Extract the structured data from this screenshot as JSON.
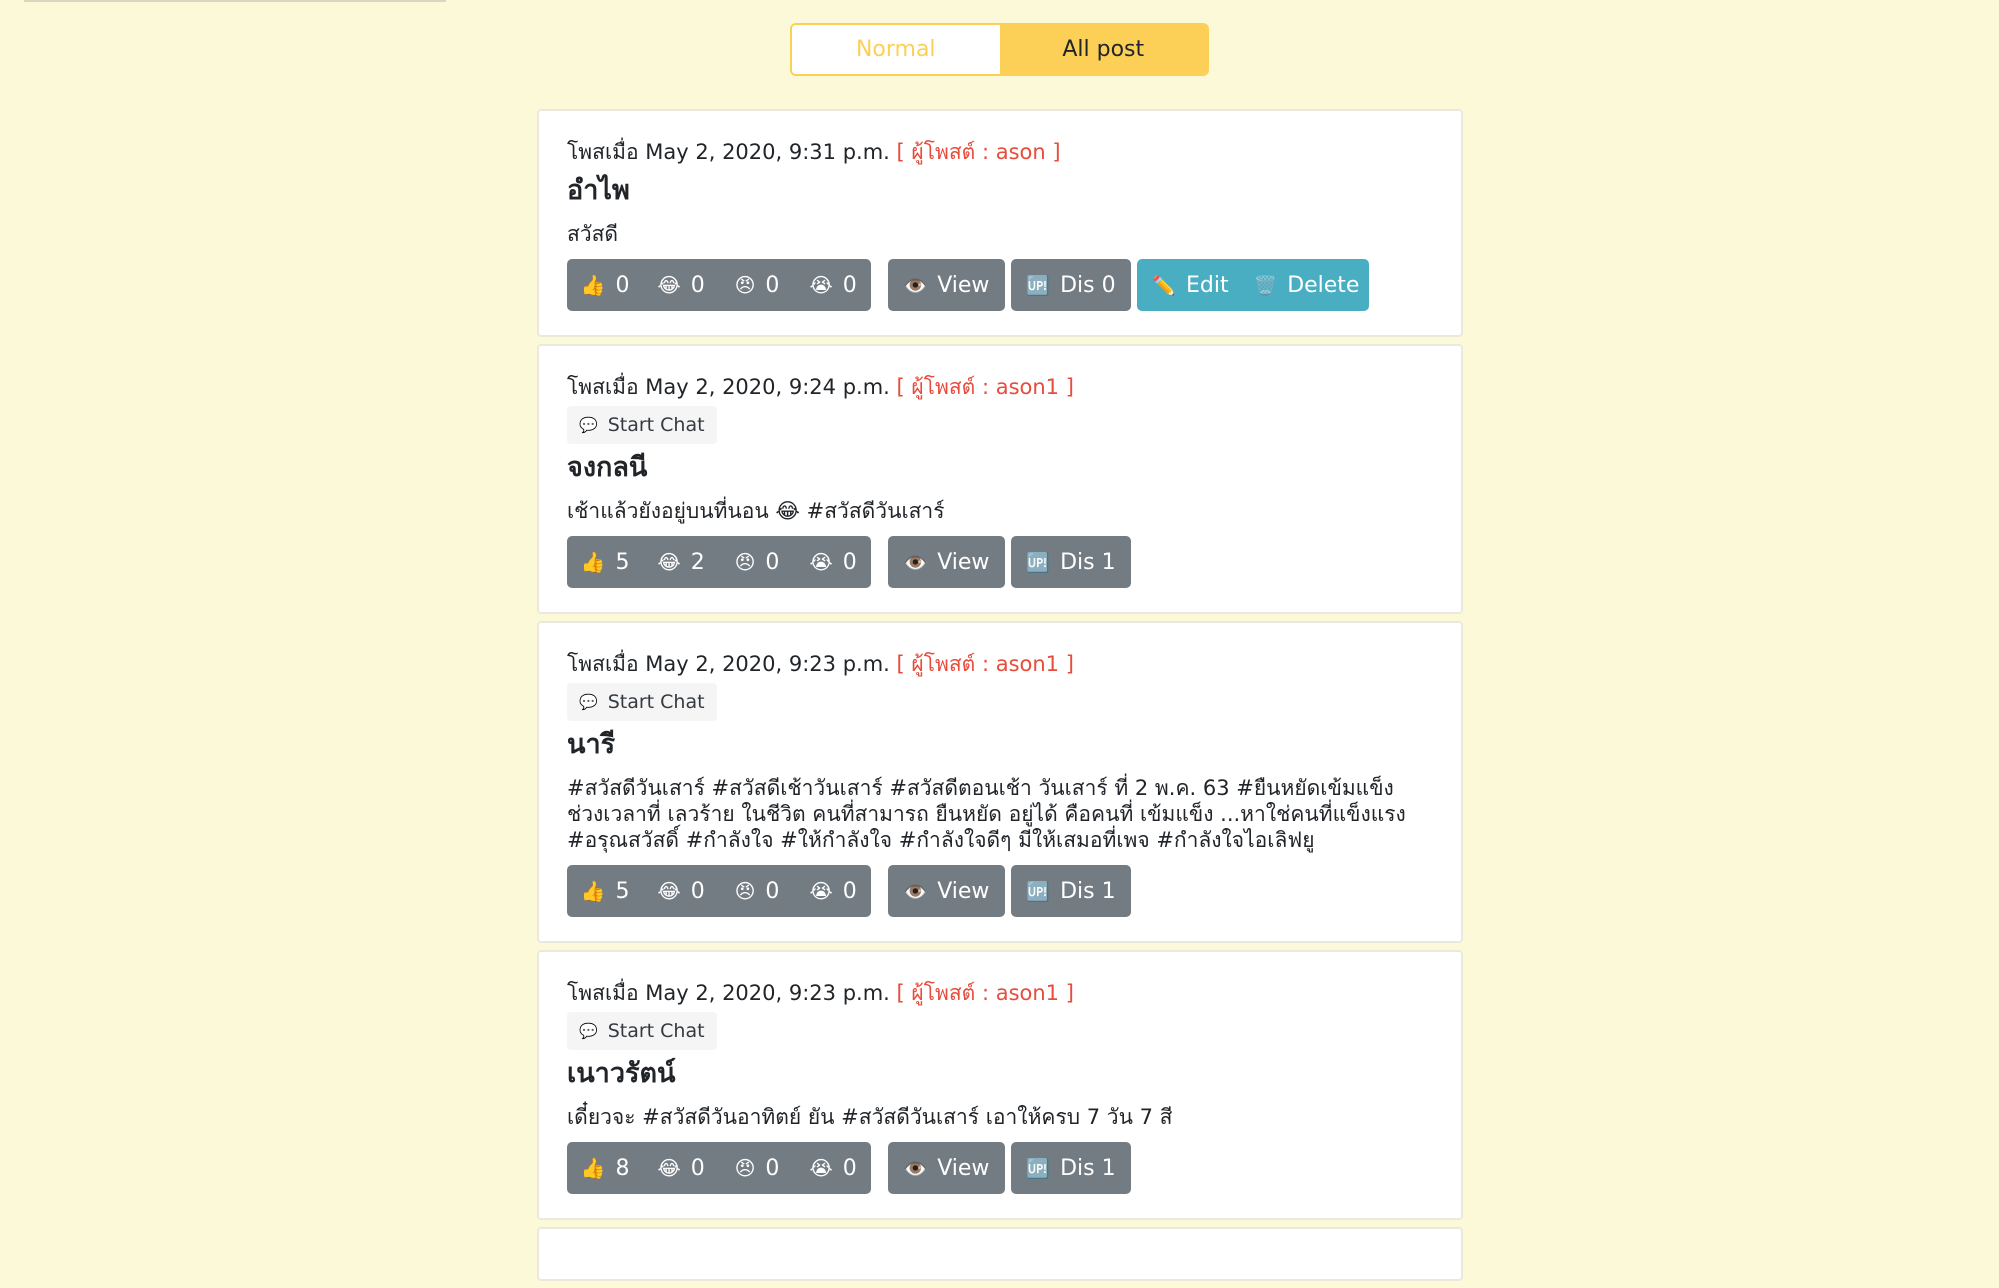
{
  "tabs": {
    "normal": "Normal",
    "all_post": "All post"
  },
  "chat_label": "Start Chat",
  "labels": {
    "view": "View",
    "edit": "Edit",
    "delete": "Delete"
  },
  "icons": {
    "like": "👍",
    "laugh": "😂",
    "angry": "😠",
    "cry": "😭",
    "eye": "👁️",
    "dis": "🆙",
    "edit": "✏️",
    "delete": "🗑️",
    "chat": "💬"
  },
  "colors": {
    "accent": "#fcd057",
    "author": "#e74c3c",
    "button": "#737b83",
    "owner_button": "#4aaec3"
  },
  "posts": [
    {
      "posted_prefix": "โพสเมื่อ",
      "date": "May 2, 2020, 9:31 p.m.",
      "author": "[ ผู้โพสต์ : ason ]",
      "title": "อำไพ",
      "text": "สวัสดี",
      "reactions": {
        "like": "0",
        "laugh": "0",
        "angry": "0",
        "cry": "0"
      },
      "dis": "Dis 0"
    },
    {
      "posted_prefix": "โพสเมื่อ",
      "date": "May 2, 2020, 9:24 p.m.",
      "author": "[ ผู้โพสต์ : ason1 ]",
      "title": "จงกลนี",
      "text": "เช้าแล้วยังอยู่บนที่นอน 😂  #สวัสดีวันเสาร์",
      "reactions": {
        "like": "5",
        "laugh": "2",
        "angry": "0",
        "cry": "0"
      },
      "dis": "Dis 1"
    },
    {
      "posted_prefix": "โพสเมื่อ",
      "date": "May 2, 2020, 9:23 p.m.",
      "author": "[ ผู้โพสต์ : ason1 ]",
      "title": "นารี",
      "text": "#สวัสดีวันเสาร์ #สวัสดีเช้าวันเสาร์ #สวัสดีตอนเช้า วันเสาร์ ที่ 2 พ.ค. 63 #ยืนหยัดเข้มแข็ง ช่วงเวลาที่ เลวร้าย ในชีวิต คนที่สามารถ ยืนหยัด อยู่ได้ คือคนที่ เข้มแข็ง ...หาใช่คนที่แข็งแรง #อรุณสวัสดิ์ #กำลังใจ #ให้กำลังใจ #กำลังใจดีๆ มีให้เสมอที่เพจ #กำลังใจไอเลิฟยู",
      "reactions": {
        "like": "5",
        "laugh": "0",
        "angry": "0",
        "cry": "0"
      },
      "dis": "Dis 1"
    },
    {
      "posted_prefix": "โพสเมื่อ",
      "date": "May 2, 2020, 9:23 p.m.",
      "author": "[ ผู้โพสต์ : ason1 ]",
      "title": "เนาวรัตน์",
      "text": "เดี๋ยวจะ #สวัสดีวันอาทิตย์ ยัน #สวัสดีวันเสาร์ เอาให้ครบ 7 วัน 7 สี",
      "reactions": {
        "like": "8",
        "laugh": "0",
        "angry": "0",
        "cry": "0"
      },
      "dis": "Dis 1"
    }
  ]
}
